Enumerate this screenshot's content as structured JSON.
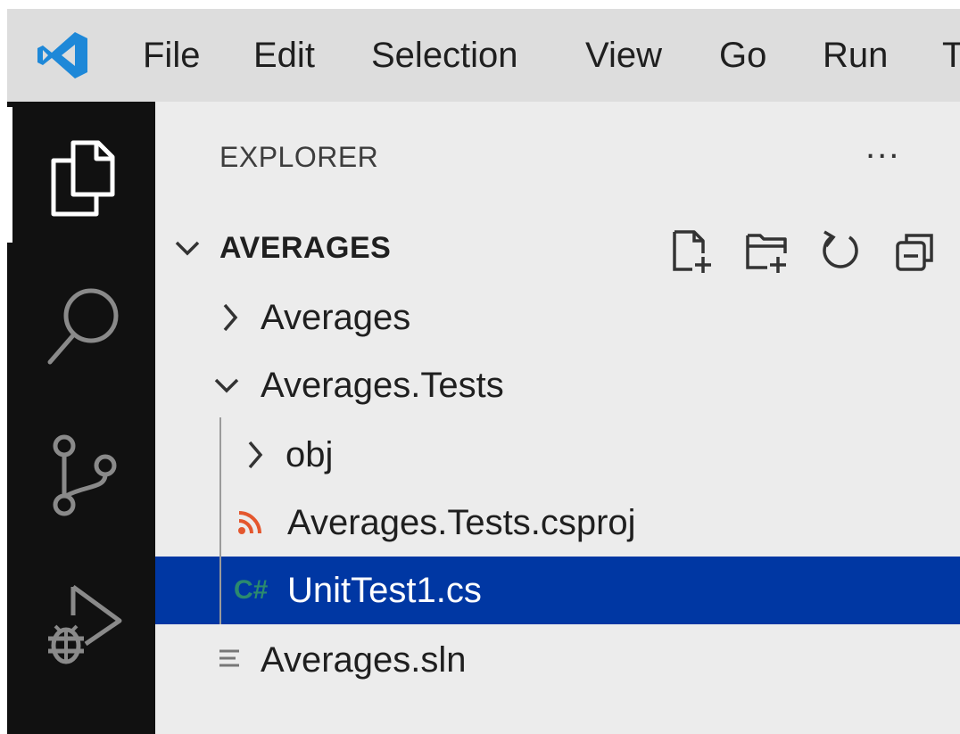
{
  "menubar": {
    "items": [
      "File",
      "Edit",
      "Selection",
      "View",
      "Go",
      "Run",
      "T"
    ]
  },
  "activity_bar": {
    "items": [
      {
        "icon": "explorer-icon",
        "active": true
      },
      {
        "icon": "search-icon",
        "active": false
      },
      {
        "icon": "source-control-icon",
        "active": false
      },
      {
        "icon": "run-debug-icon",
        "active": false
      }
    ]
  },
  "explorer": {
    "title": "EXPLORER",
    "more": "...",
    "section": {
      "name": "AVERAGES",
      "actions": [
        "new-file-icon",
        "new-folder-icon",
        "refresh-icon",
        "collapse-all-icon"
      ]
    },
    "tree": [
      {
        "label": "Averages",
        "type": "folder",
        "expanded": false,
        "depth": 0
      },
      {
        "label": "Averages.Tests",
        "type": "folder",
        "expanded": true,
        "depth": 0
      },
      {
        "label": "obj",
        "type": "folder",
        "expanded": false,
        "depth": 1
      },
      {
        "label": "Averages.Tests.csproj",
        "type": "file",
        "icon": "rss-feed-icon",
        "depth": 1
      },
      {
        "label": "UnitTest1.cs",
        "type": "file",
        "icon": "csharp-icon",
        "icon_text": "C#",
        "depth": 1,
        "selected": true
      },
      {
        "label": "Averages.sln",
        "type": "file",
        "icon": "lines-icon",
        "depth": 0
      }
    ]
  },
  "colors": {
    "selection": "#0037a3",
    "activity_bar": "#111111",
    "sidebar": "#ececec",
    "menubar": "#dddddd",
    "vscode_blue": "#1e88d8",
    "csproj_orange": "#e4572e",
    "csharp_teal": "#2b8a6e"
  }
}
